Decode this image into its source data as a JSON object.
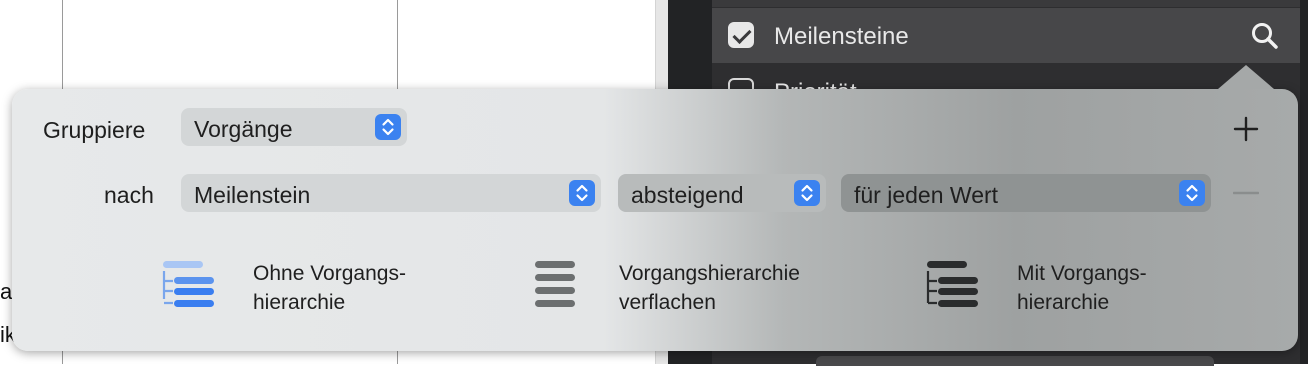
{
  "background": {
    "sidebar": {
      "rows": [
        {
          "label": "Meilensteine",
          "checked": true
        },
        {
          "label": "Priorität",
          "checked": false
        }
      ]
    },
    "partial_text": [
      "ag",
      "ik"
    ]
  },
  "popover": {
    "group_label": "Gruppiere",
    "group_value": "Vorgänge",
    "by_label": "nach",
    "field_value": "Meilenstein",
    "order_value": "absteigend",
    "mode_value": "für jeden Wert",
    "options": [
      {
        "line1": "Ohne Vorgangs-",
        "line2": "hierarchie",
        "icon": "hierarchy-blue-icon"
      },
      {
        "line1": "Vorgangshierarchie",
        "line2": "verflachen",
        "icon": "flat-list-icon"
      },
      {
        "line1": "Mit Vorgangs-",
        "line2": "hierarchie",
        "icon": "hierarchy-dark-icon"
      }
    ]
  },
  "colors": {
    "accent": "#3b82f0",
    "panel_dark": "#2e2e30"
  }
}
